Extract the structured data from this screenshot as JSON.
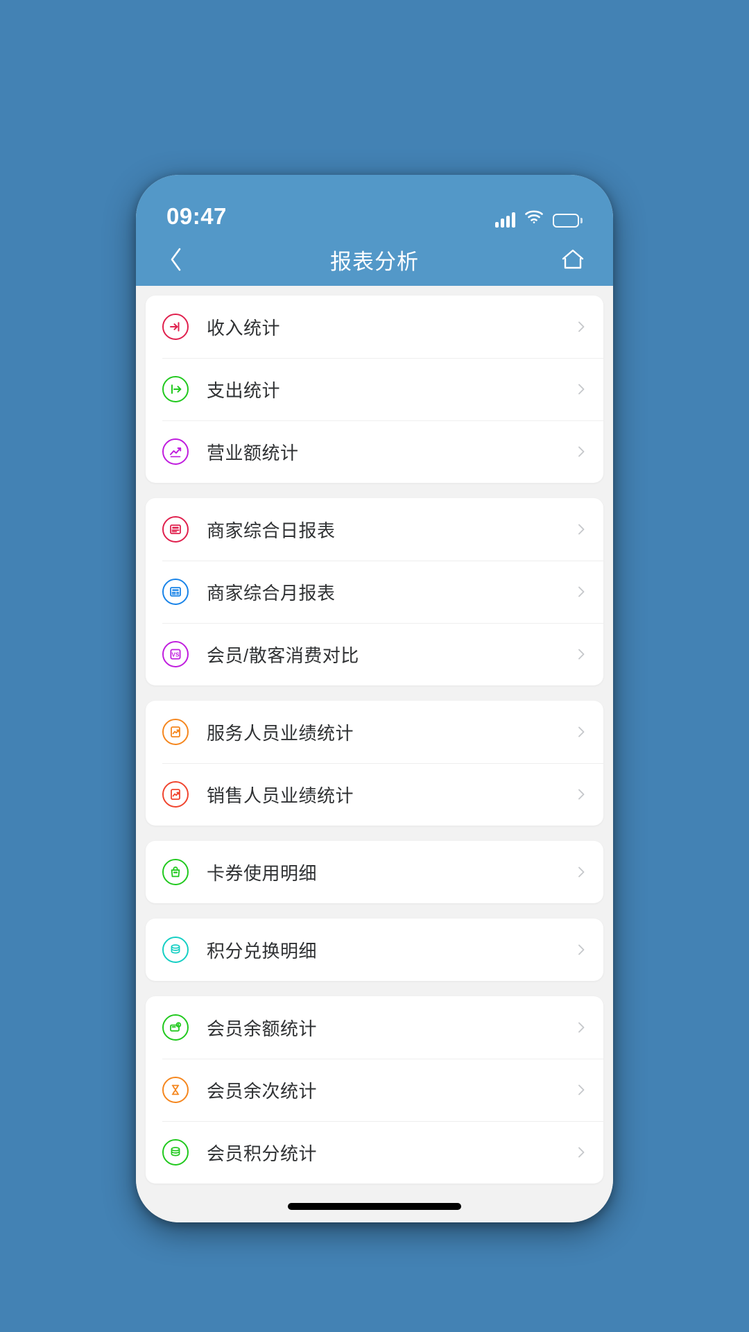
{
  "theme": {
    "page_bg": "#4382b4",
    "header_bg": "#5398c8",
    "content_bg": "#f2f2f2",
    "card_bg": "#ffffff",
    "label_color": "#2f3133",
    "chevron_color": "#c6c8cb"
  },
  "status_bar": {
    "time": "09:47",
    "signal_icon": "signal-bars-icon",
    "wifi_icon": "wifi-icon",
    "battery_icon": "battery-icon"
  },
  "nav": {
    "back_icon": "chevron-left-icon",
    "title": "报表分析",
    "home_icon": "home-icon"
  },
  "groups": [
    {
      "rows": [
        {
          "label": "收入统计",
          "icon": "income-arrow-in-icon",
          "color": "#e0214e"
        },
        {
          "label": "支出统计",
          "icon": "expense-arrow-out-icon",
          "color": "#22c91f"
        },
        {
          "label": "营业额统计",
          "icon": "turnover-chart-icon",
          "color": "#c01ede"
        }
      ]
    },
    {
      "rows": [
        {
          "label": "商家综合日报表",
          "icon": "daily-report-icon",
          "color": "#e0214e"
        },
        {
          "label": "商家综合月报表",
          "icon": "monthly-report-icon",
          "color": "#1a84e8"
        },
        {
          "label": "会员/散客消费对比",
          "icon": "vs-compare-icon",
          "color": "#c01ede"
        }
      ]
    },
    {
      "rows": [
        {
          "label": "服务人员业绩统计",
          "icon": "service-performance-icon",
          "color": "#f5871f"
        },
        {
          "label": "销售人员业绩统计",
          "icon": "sales-performance-icon",
          "color": "#f0452f"
        }
      ]
    },
    {
      "rows": [
        {
          "label": "卡券使用明细",
          "icon": "coupon-bag-icon",
          "color": "#22c91f"
        }
      ]
    },
    {
      "rows": [
        {
          "label": "积分兑换明细",
          "icon": "points-coins-icon",
          "color": "#16cfc4"
        }
      ]
    },
    {
      "rows": [
        {
          "label": "会员余额统计",
          "icon": "member-balance-wallet-icon",
          "color": "#22c91f"
        },
        {
          "label": "会员余次统计",
          "icon": "member-times-hourglass-icon",
          "color": "#f5871f"
        },
        {
          "label": "会员积分统计",
          "icon": "member-points-coins-icon",
          "color": "#22c91f"
        }
      ]
    }
  ],
  "home_indicator": "home-indicator-bar"
}
